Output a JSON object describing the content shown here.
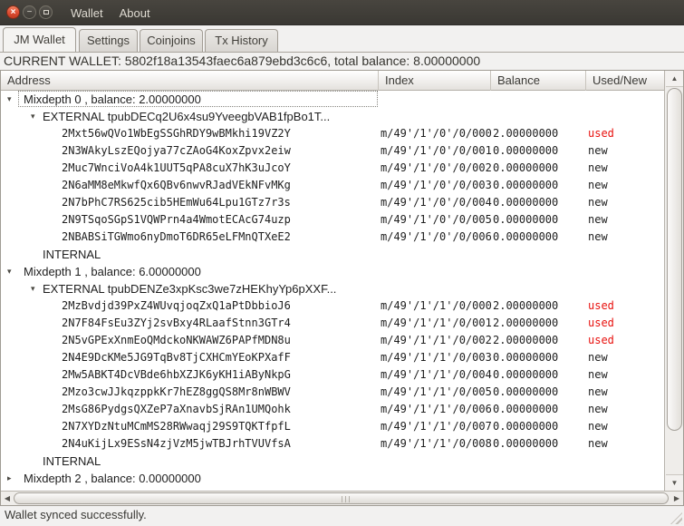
{
  "window": {
    "menubar": [
      "Wallet",
      "About"
    ],
    "controls": {
      "close_glyph": "×",
      "minimize_glyph": "−"
    }
  },
  "tabs": [
    {
      "label": "JM Wallet",
      "active": true
    },
    {
      "label": "Settings",
      "active": false
    },
    {
      "label": "Coinjoins",
      "active": false
    },
    {
      "label": "Tx History",
      "active": false
    }
  ],
  "current_wallet_label": "CURRENT WALLET: 5802f18a13543faec6a879ebd3c6c6, total balance: 8.00000000",
  "icons": {
    "expander_open": "▾",
    "expander_collapsed": "▸",
    "scroll_up": "▲",
    "scroll_down": "▼",
    "scroll_left": "◀",
    "scroll_right": "▶"
  },
  "colors": {
    "used": "#e8110e",
    "new": "#1e1e1e",
    "accent_close": "#dd4c32"
  },
  "table": {
    "columns": [
      "Address",
      "Index",
      "Balance",
      "Used/New"
    ],
    "rows": [
      {
        "level": 1,
        "expander": "open",
        "focused": true,
        "mono": false,
        "address": "Mixdepth 0 , balance: 2.00000000",
        "index": "",
        "balance": "",
        "status": ""
      },
      {
        "level": 2,
        "expander": "open",
        "mono": false,
        "address": "EXTERNAL tpubDECq2U6x4su9YveegbVAB1fpBo1T...",
        "index": "",
        "balance": "",
        "status": ""
      },
      {
        "level": 3,
        "mono": true,
        "address": "2Mxt56wQVo1WbEgSSGhRDY9wBMkhi19VZ2Y",
        "index": "m/49'/1'/0'/0/000",
        "balance": "2.00000000",
        "status": "used"
      },
      {
        "level": 3,
        "mono": true,
        "address": "2N3WAkyLszEQojya77cZAoG4KoxZpvx2eiw",
        "index": "m/49'/1'/0'/0/001",
        "balance": "0.00000000",
        "status": "new"
      },
      {
        "level": 3,
        "mono": true,
        "address": "2Muc7WnciVoA4k1UUT5qPA8cuX7hK3uJcoY",
        "index": "m/49'/1'/0'/0/002",
        "balance": "0.00000000",
        "status": "new"
      },
      {
        "level": 3,
        "mono": true,
        "address": "2N6aMM8eMkwfQx6QBv6nwvRJadVEkNFvMKg",
        "index": "m/49'/1'/0'/0/003",
        "balance": "0.00000000",
        "status": "new"
      },
      {
        "level": 3,
        "mono": true,
        "address": "2N7bPhC7RS625cib5HEmWu64Lpu1GTz7r3s",
        "index": "m/49'/1'/0'/0/004",
        "balance": "0.00000000",
        "status": "new"
      },
      {
        "level": 3,
        "mono": true,
        "address": "2N9TSqoSGpS1VQWPrn4a4WmotECAcG74uzp",
        "index": "m/49'/1'/0'/0/005",
        "balance": "0.00000000",
        "status": "new"
      },
      {
        "level": 3,
        "mono": true,
        "address": "2NBABSiTGWmo6nyDmoT6DR65eLFMnQTXeE2",
        "index": "m/49'/1'/0'/0/006",
        "balance": "0.00000000",
        "status": "new"
      },
      {
        "level": 2,
        "mono": false,
        "address": "INTERNAL",
        "index": "",
        "balance": "",
        "status": ""
      },
      {
        "level": 1,
        "expander": "open",
        "mono": false,
        "address": "Mixdepth 1 , balance: 6.00000000",
        "index": "",
        "balance": "",
        "status": ""
      },
      {
        "level": 2,
        "expander": "open",
        "mono": false,
        "address": "EXTERNAL tpubDENZe3xpKsc3we7zHEKhyYp6pXXF...",
        "index": "",
        "balance": "",
        "status": ""
      },
      {
        "level": 3,
        "mono": true,
        "address": "2MzBvdjd39PxZ4WUvqjoqZxQ1aPtDbbioJ6",
        "index": "m/49'/1'/1'/0/000",
        "balance": "2.00000000",
        "status": "used"
      },
      {
        "level": 3,
        "mono": true,
        "address": "2N7F84FsEu3ZYj2svBxy4RLaafStnn3GTr4",
        "index": "m/49'/1'/1'/0/001",
        "balance": "2.00000000",
        "status": "used"
      },
      {
        "level": 3,
        "mono": true,
        "address": "2N5vGPExXnmEoQMdckoNKWAWZ6PAPfMDN8u",
        "index": "m/49'/1'/1'/0/002",
        "balance": "2.00000000",
        "status": "used"
      },
      {
        "level": 3,
        "mono": true,
        "address": "2N4E9DcKMe5JG9TqBv8TjCXHCmYEoKPXafF",
        "index": "m/49'/1'/1'/0/003",
        "balance": "0.00000000",
        "status": "new"
      },
      {
        "level": 3,
        "mono": true,
        "address": "2Mw5ABKT4DcVBde6hbXZJK6yKH1iAByNkpG",
        "index": "m/49'/1'/1'/0/004",
        "balance": "0.00000000",
        "status": "new"
      },
      {
        "level": 3,
        "mono": true,
        "address": "2Mzo3cwJJkqzppkKr7hEZ8ggQS8Mr8nWBWV",
        "index": "m/49'/1'/1'/0/005",
        "balance": "0.00000000",
        "status": "new"
      },
      {
        "level": 3,
        "mono": true,
        "address": "2MsG86PydgsQXZeP7aXnavbSjRAn1UMQohk",
        "index": "m/49'/1'/1'/0/006",
        "balance": "0.00000000",
        "status": "new"
      },
      {
        "level": 3,
        "mono": true,
        "address": "2N7XYDzNtuMCmMS28RWwaqj29S9TQKTfpfL",
        "index": "m/49'/1'/1'/0/007",
        "balance": "0.00000000",
        "status": "new"
      },
      {
        "level": 3,
        "mono": true,
        "address": "2N4uKijLx9ESsN4zjVzM5jwTBJrhTVUVfsA",
        "index": "m/49'/1'/1'/0/008",
        "balance": "0.00000000",
        "status": "new"
      },
      {
        "level": 2,
        "mono": false,
        "address": "INTERNAL",
        "index": "",
        "balance": "",
        "status": ""
      },
      {
        "level": 1,
        "expander": "collapsed",
        "mono": false,
        "address": "Mixdepth 2 , balance: 0.00000000",
        "index": "",
        "balance": "",
        "status": ""
      }
    ]
  },
  "status_bar": {
    "text": "Wallet synced successfully."
  }
}
